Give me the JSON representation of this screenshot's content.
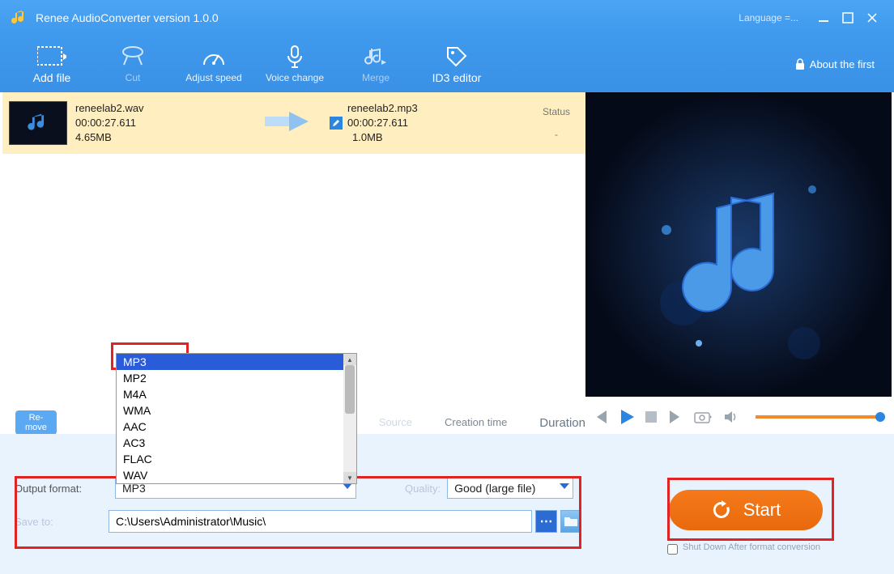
{
  "app": {
    "title": "Renee AudioConverter version 1.0.0",
    "language": "Language =..."
  },
  "toolbar": {
    "add_file": "Add file",
    "cut": "Cut",
    "adjust_speed": "Adjust speed",
    "voice_change": "Voice change",
    "merge": "Merge",
    "id3_editor": "ID3 editor",
    "about": "About the first"
  },
  "source": {
    "name": "reneelab2.wav",
    "duration": "00:00:27.611",
    "size": "4.65MB"
  },
  "target": {
    "name": "reneelab2.mp3",
    "duration": "00:00:27.611",
    "size": "1.0MB"
  },
  "status": {
    "label": "Status",
    "value": "-"
  },
  "remove_btn": "Re-\nmove",
  "columns": {
    "source": "Source",
    "creation": "Creation time",
    "duration": "Duration"
  },
  "formats": [
    "MP3",
    "MP2",
    "M4A",
    "WMA",
    "AAC",
    "AC3",
    "FLAC",
    "WAV"
  ],
  "settings": {
    "output_format_label": "Output format:",
    "output_format_value": "MP3",
    "quality_label": "Quality:",
    "quality_value": "Good (large file)",
    "save_to_label": "Save to:",
    "save_to_value": "C:\\Users\\Administrator\\Music\\"
  },
  "start": "Start",
  "shutdown": "Shut Down After format conversion"
}
